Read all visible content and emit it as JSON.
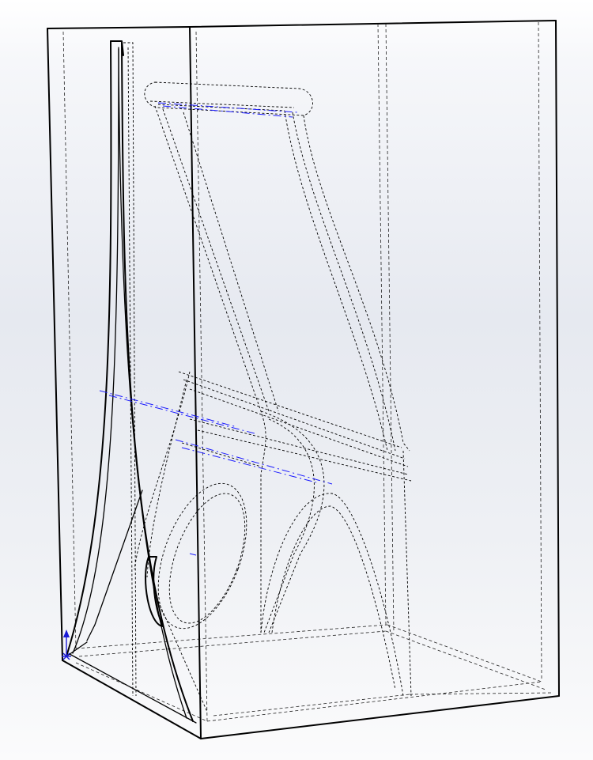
{
  "viewport": {
    "background_top": "#ffffff",
    "background_mid": "#e6e9f0",
    "background_bottom": "#fbfbfc",
    "visible_edge_color": "#000000",
    "hidden_edge_color": "#000000",
    "sketch_color": "#1a1aff"
  },
  "model": {
    "display_mode": "hidden-lines-visible",
    "view": "isometric"
  },
  "triad": {
    "icon": "origin-triad-icon",
    "color": "#1a1ad6"
  }
}
